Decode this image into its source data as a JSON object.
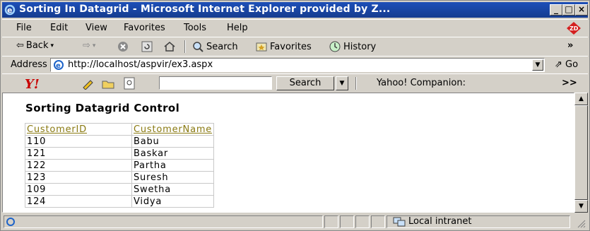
{
  "window": {
    "title": "Sorting In Datagrid - Microsoft Internet Explorer provided by Z..."
  },
  "menu": [
    {
      "label": "File"
    },
    {
      "label": "Edit"
    },
    {
      "label": "View"
    },
    {
      "label": "Favorites"
    },
    {
      "label": "Tools"
    },
    {
      "label": "Help"
    }
  ],
  "toolbar": {
    "back": "Back",
    "search": "Search",
    "favorites": "Favorites",
    "history": "History",
    "more": "»"
  },
  "address": {
    "label": "Address",
    "url": "http://localhost/aspvir/ex3.aspx",
    "go": "Go"
  },
  "yahoo": {
    "search_value": "",
    "search_button": "Search",
    "companion": "Yahoo! Companion:",
    "more": ">>"
  },
  "page": {
    "heading": "Sorting Datagrid Control",
    "grid": {
      "headers": [
        "CustomerID",
        "CustomerName"
      ],
      "rows": [
        [
          "110",
          "Babu"
        ],
        [
          "121",
          "Baskar"
        ],
        [
          "122",
          "Partha"
        ],
        [
          "123",
          "Suresh"
        ],
        [
          "109",
          "Swetha"
        ],
        [
          "124",
          "Vidya"
        ]
      ]
    }
  },
  "status": {
    "zone": "Local intranet"
  },
  "colors": {
    "titlebar": "#1d4fb8",
    "link_header": "#8a7a12",
    "chrome": "#d4d0c8"
  }
}
